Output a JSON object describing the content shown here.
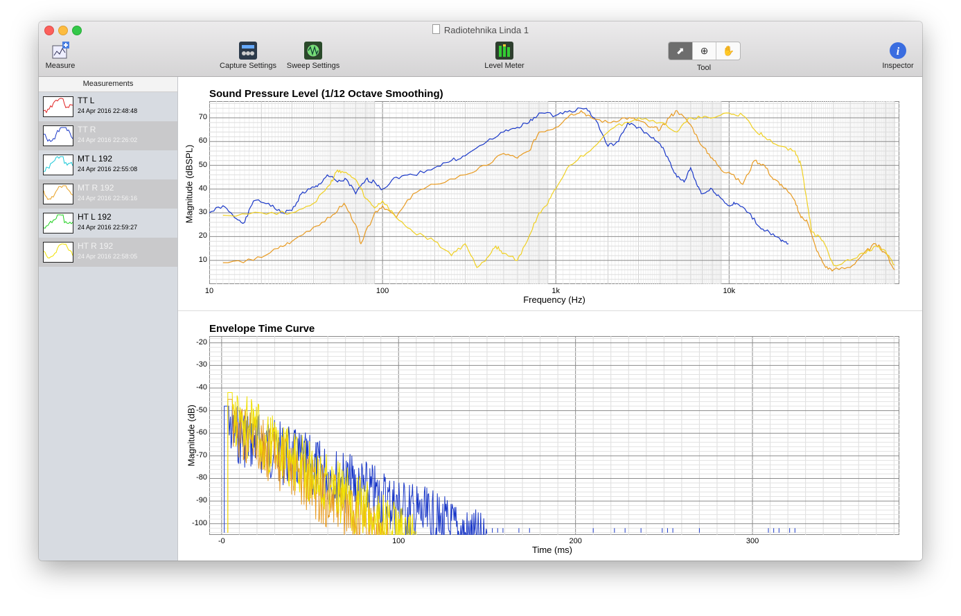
{
  "window": {
    "title": "Radiotehnika Linda 1"
  },
  "toolbar": {
    "measure": "Measure",
    "capture_settings": "Capture Settings",
    "sweep_settings": "Sweep Settings",
    "level_meter": "Level Meter",
    "tool": "Tool",
    "inspector": "Inspector",
    "tool_icons": [
      "pointer-icon",
      "zoom-in-icon",
      "hand-icon"
    ],
    "selected_tool": "pointer"
  },
  "sidebar": {
    "header": "Measurements",
    "items": [
      {
        "name": "TT L",
        "date": "24 Apr 2016 22:48:48",
        "color": "#e02020",
        "dimmed": false
      },
      {
        "name": "TT R",
        "date": "24 Apr 2016 22:26:02",
        "color": "#1a38c8",
        "dimmed": true
      },
      {
        "name": "MT L 192",
        "date": "24 Apr 2016 22:55:08",
        "color": "#18c8d8",
        "dimmed": false
      },
      {
        "name": "MT R 192",
        "date": "24 Apr 2016 22:56:16",
        "color": "#e8a020",
        "dimmed": true
      },
      {
        "name": "HT L 192",
        "date": "24 Apr 2016 22:59:27",
        "color": "#20d020",
        "dimmed": false
      },
      {
        "name": "HT R 192",
        "date": "24 Apr 2016 22:58:05",
        "color": "#f0e000",
        "dimmed": true
      }
    ]
  },
  "chart_data": [
    {
      "type": "line",
      "title": "Sound Pressure Level (1/12 Octave Smoothing)",
      "xlabel": "Frequency (Hz)",
      "ylabel": "Magnitude (dBSPL)",
      "x_scale": "log",
      "xlim": [
        10,
        96000
      ],
      "ylim": [
        0,
        77
      ],
      "x_ticks": [
        "10",
        "100",
        "1k",
        "10k"
      ],
      "y_ticks": [
        "10",
        "20",
        "30",
        "40",
        "50",
        "60",
        "70"
      ],
      "grid": true,
      "series": [
        {
          "color": "#1a38c8",
          "points": [
            [
              10,
              30
            ],
            [
              12,
              33
            ],
            [
              14,
              28
            ],
            [
              16,
              26
            ],
            [
              18,
              35
            ],
            [
              22,
              34
            ],
            [
              26,
              30
            ],
            [
              30,
              31
            ],
            [
              34,
              38
            ],
            [
              38,
              40
            ],
            [
              42,
              41
            ],
            [
              48,
              46
            ],
            [
              55,
              43
            ],
            [
              62,
              44
            ],
            [
              70,
              38
            ],
            [
              80,
              44
            ],
            [
              90,
              43
            ],
            [
              100,
              40
            ],
            [
              120,
              45
            ],
            [
              150,
              46
            ],
            [
              200,
              49
            ],
            [
              250,
              52
            ],
            [
              300,
              54
            ],
            [
              400,
              60
            ],
            [
              500,
              64
            ],
            [
              600,
              66
            ],
            [
              700,
              68
            ],
            [
              800,
              72
            ],
            [
              1000,
              71
            ],
            [
              1200,
              73
            ],
            [
              1500,
              74
            ],
            [
              1700,
              69
            ],
            [
              2000,
              58
            ],
            [
              2300,
              60
            ],
            [
              2600,
              68
            ],
            [
              3000,
              66
            ],
            [
              3500,
              62
            ],
            [
              4000,
              59
            ],
            [
              4500,
              52
            ],
            [
              5000,
              45
            ],
            [
              5500,
              43
            ],
            [
              6000,
              49
            ],
            [
              6500,
              42
            ],
            [
              7000,
              38
            ],
            [
              8000,
              40
            ],
            [
              9000,
              36
            ],
            [
              10000,
              33
            ],
            [
              11000,
              34
            ],
            [
              13000,
              30
            ],
            [
              15000,
              24
            ],
            [
              17000,
              22
            ],
            [
              20000,
              18
            ],
            [
              22000,
              17
            ]
          ]
        },
        {
          "color": "#e89a20",
          "points": [
            [
              12,
              9
            ],
            [
              18,
              10
            ],
            [
              25,
              15
            ],
            [
              30,
              18
            ],
            [
              40,
              24
            ],
            [
              50,
              28
            ],
            [
              60,
              34
            ],
            [
              70,
              25
            ],
            [
              75,
              17
            ],
            [
              90,
              30
            ],
            [
              100,
              33
            ],
            [
              120,
              28
            ],
            [
              150,
              38
            ],
            [
              200,
              42
            ],
            [
              300,
              46
            ],
            [
              400,
              50
            ],
            [
              500,
              55
            ],
            [
              600,
              53
            ],
            [
              700,
              56
            ],
            [
              800,
              64
            ],
            [
              1000,
              66
            ],
            [
              1200,
              71
            ],
            [
              1400,
              73
            ],
            [
              1600,
              70
            ],
            [
              2000,
              68
            ],
            [
              2500,
              70
            ],
            [
              3000,
              69
            ],
            [
              3500,
              66
            ],
            [
              4000,
              65
            ],
            [
              4500,
              70
            ],
            [
              5000,
              73
            ],
            [
              6000,
              67
            ],
            [
              7000,
              58
            ],
            [
              8000,
              53
            ],
            [
              9000,
              48
            ],
            [
              10000,
              47
            ],
            [
              12000,
              42
            ],
            [
              14000,
              52
            ],
            [
              16000,
              50
            ],
            [
              18000,
              44
            ],
            [
              20000,
              42
            ],
            [
              24000,
              35
            ],
            [
              26000,
              28
            ],
            [
              28000,
              27
            ],
            [
              32000,
              14
            ],
            [
              36000,
              7
            ],
            [
              40000,
              6
            ],
            [
              50000,
              7
            ],
            [
              60000,
              13
            ],
            [
              70000,
              17
            ],
            [
              80000,
              13
            ],
            [
              90000,
              6
            ]
          ]
        },
        {
          "color": "#f0d020",
          "points": [
            [
              12,
              29
            ],
            [
              20,
              30
            ],
            [
              30,
              30
            ],
            [
              40,
              34
            ],
            [
              50,
              42
            ],
            [
              55,
              48
            ],
            [
              60,
              47
            ],
            [
              70,
              44
            ],
            [
              80,
              36
            ],
            [
              90,
              32
            ],
            [
              100,
              35
            ],
            [
              120,
              28
            ],
            [
              150,
              22
            ],
            [
              200,
              18
            ],
            [
              250,
              12
            ],
            [
              300,
              17
            ],
            [
              350,
              7
            ],
            [
              400,
              11
            ],
            [
              450,
              16
            ],
            [
              500,
              13
            ],
            [
              600,
              10
            ],
            [
              700,
              20
            ],
            [
              800,
              30
            ],
            [
              900,
              34
            ],
            [
              1000,
              40
            ],
            [
              1200,
              50
            ],
            [
              1500,
              55
            ],
            [
              2000,
              64
            ],
            [
              2500,
              68
            ],
            [
              3000,
              70
            ],
            [
              4000,
              68
            ],
            [
              5000,
              64
            ],
            [
              6000,
              70
            ],
            [
              7000,
              70
            ],
            [
              8000,
              70
            ],
            [
              10000,
              72
            ],
            [
              12000,
              71
            ],
            [
              14000,
              65
            ],
            [
              16000,
              62
            ],
            [
              20000,
              58
            ],
            [
              24000,
              56
            ],
            [
              26000,
              50
            ],
            [
              28000,
              36
            ],
            [
              30000,
              22
            ],
            [
              35000,
              18
            ],
            [
              40000,
              8
            ],
            [
              50000,
              10
            ],
            [
              60000,
              13
            ],
            [
              70000,
              16
            ],
            [
              80000,
              14
            ],
            [
              90000,
              8
            ]
          ]
        }
      ]
    },
    {
      "type": "line",
      "title": "Envelope Time Curve",
      "xlabel": "Time (ms)",
      "ylabel": "Magnitude (dB)",
      "xlim": [
        -7,
        383
      ],
      "ylim": [
        -105,
        -17
      ],
      "x_ticks": [
        "-0",
        "100",
        "200",
        "300"
      ],
      "y_ticks": [
        "-20",
        "-30",
        "-40",
        "-50",
        "-60",
        "-70",
        "-80",
        "-90",
        "-100"
      ],
      "grid": true,
      "series": [
        {
          "color": "#1a38c8",
          "peak_time": 3,
          "peak_db": -48,
          "decay_end_time": 150,
          "tail_end_time": 326
        },
        {
          "color": "#e89a20",
          "peak_time": 5,
          "peak_db": -45,
          "decay_end_time": 95
        },
        {
          "color": "#f0e000",
          "peak_time": 5,
          "peak_db": -42,
          "decay_end_time": 110
        }
      ]
    }
  ]
}
